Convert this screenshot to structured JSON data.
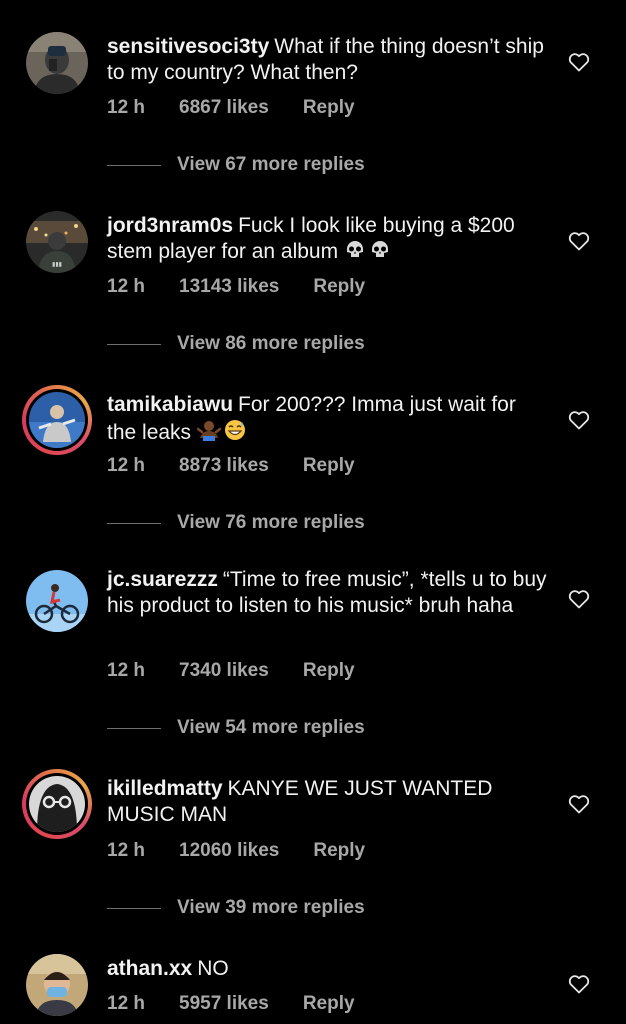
{
  "comments": [
    {
      "username": "sensitivesoci3ty",
      "text": "What if the thing doesn’t ship to my country? What then?",
      "time": "12 h",
      "likes": "6867 likes",
      "reply": "Reply",
      "view_replies": "View 67 more replies",
      "avatar_icon": "user-avatar-mirror-selfie"
    },
    {
      "username": "jord3nram0s",
      "text": "Fuck I look like buying a $200 stem player for an album",
      "emojis": [
        "skull-emoji",
        "skull-emoji"
      ],
      "time": "12 h",
      "likes": "13143 likes",
      "reply": "Reply",
      "view_replies": "View 86 more replies",
      "avatar_icon": "user-avatar-city-night"
    },
    {
      "username": "tamikabiawu",
      "text": "For 200??? Imma just wait for the leaks",
      "emojis": [
        "person-shrugging-emoji",
        "grinning-sweat-emoji"
      ],
      "time": "12 h",
      "likes": "8873 likes",
      "reply": "Reply",
      "view_replies": "View 76 more replies",
      "avatar_icon": "user-avatar-story-ring",
      "has_story_ring": true
    },
    {
      "username": "jc.suarezzz",
      "text": "“Time to free music”, *tells u to buy his product to listen to his music* bruh haha",
      "time": "12 h",
      "likes": "7340 likes",
      "reply": "Reply",
      "view_replies": "View 54 more replies",
      "avatar_icon": "user-avatar-bmx-bike"
    },
    {
      "username": "ikilledmatty",
      "text": "KANYE WE JUST WANTED MUSIC MAN",
      "time": "12 h",
      "likes": "12060 likes",
      "reply": "Reply",
      "view_replies": "View 39 more replies",
      "avatar_icon": "user-avatar-story-ring",
      "has_story_ring": true
    },
    {
      "username": "athan.xx",
      "text": "NO",
      "time": "12 h",
      "likes": "5957 likes",
      "reply": "Reply",
      "avatar_icon": "user-avatar-masked"
    }
  ],
  "colors": {
    "background": "#000000",
    "text": "#f2f2f2",
    "secondary_text": "#a8a8a8",
    "story_ring": "#e0484f"
  }
}
